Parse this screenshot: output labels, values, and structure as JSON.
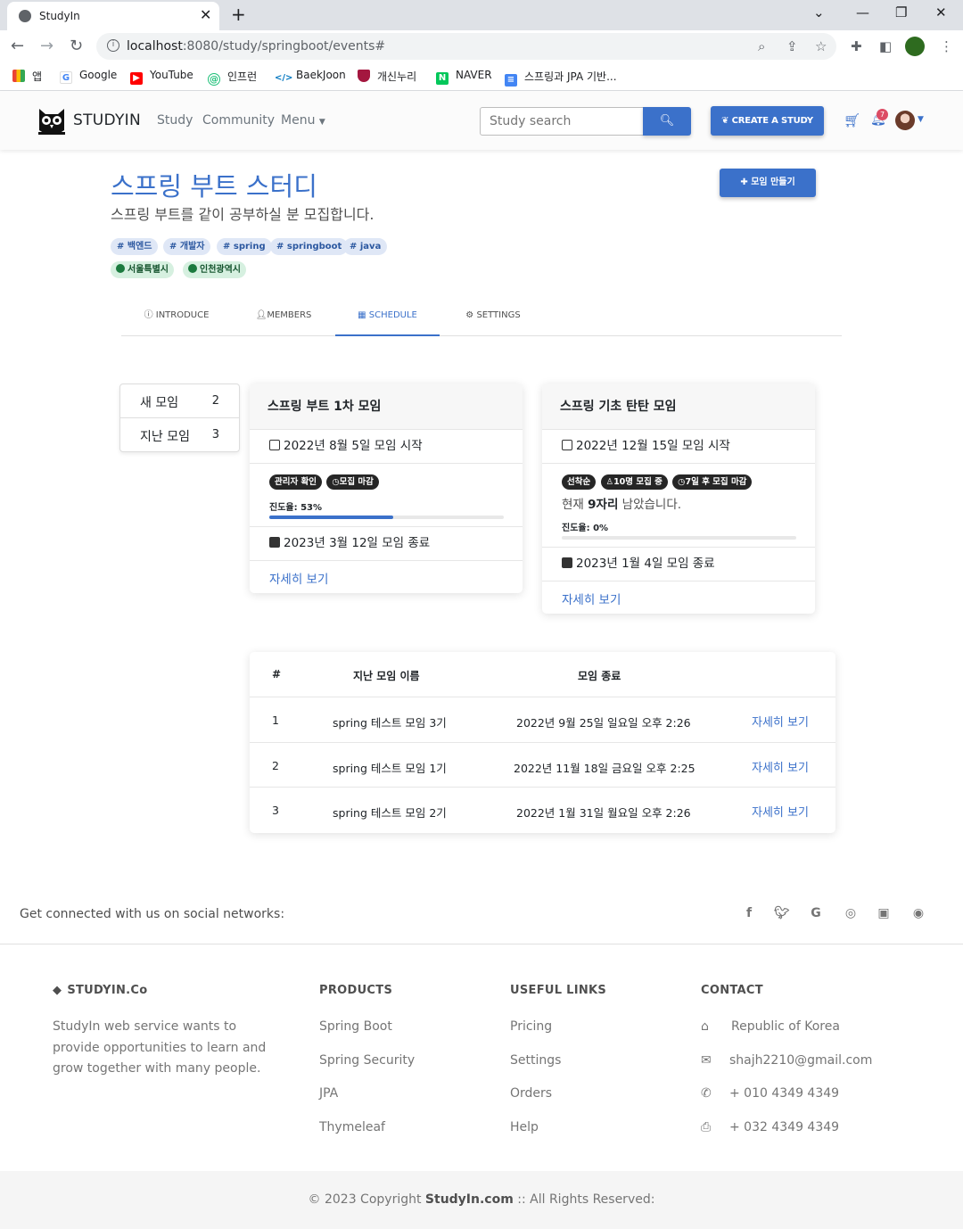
{
  "browser": {
    "tab_title": "StudyIn",
    "url_host": "localhost",
    "url_rest": ":8080/study/springboot/events#",
    "bookmarks": [
      "앱",
      "Google",
      "YouTube",
      "인프런",
      "BaekJoon",
      "개신누리",
      "NAVER",
      "스프링과 JPA 기반..."
    ]
  },
  "nav": {
    "brand": "STUDYIN",
    "links": [
      "Study",
      "Community",
      "Menu"
    ],
    "search_placeholder": "Study search",
    "create_label": "CREATE A STUDY",
    "notif_count": "7"
  },
  "study": {
    "title": "스프링 부트 스터디",
    "description": "스프링 부트를 같이 공부하실 분 모집합니다.",
    "new_meeting_label": "모임 만들기",
    "tags": [
      "백엔드",
      "개발자",
      "spring",
      "springboot",
      "java"
    ],
    "zones": [
      "서울특별시",
      "인천광역시"
    ],
    "tabs": [
      "INTRODUCE",
      "MEMBERS",
      "SCHEDULE",
      "SETTINGS"
    ]
  },
  "side": {
    "items": [
      {
        "label": "새 모임",
        "count": "2"
      },
      {
        "label": "지난 모임",
        "count": "3"
      }
    ]
  },
  "events": [
    {
      "title": "스프링 부트 1차 모임",
      "start": "2022년 8월 5일 모임 시작",
      "badges": [
        "관리자 확인",
        "모집 마감"
      ],
      "status_text": "",
      "progress_label": "진도율: 53%",
      "progress": 0.53,
      "end": "2023년 3월 12일 모임 종료",
      "link": "자세히 보기"
    },
    {
      "title": "스프링 기초 탄탄 모임",
      "start": "2022년 12월 15일 모임 시작",
      "badges": [
        "선착순",
        "10명 모집 중",
        "7일 후 모집 마감"
      ],
      "status_pre": "현재 ",
      "status_bold": "9자리",
      "status_post": " 남았습니다.",
      "progress_label": "진도율: 0%",
      "progress": 0,
      "end": "2023년 1월 4일 모임 종료",
      "link": "자세히 보기"
    }
  ],
  "past": {
    "headers": [
      "#",
      "지난 모임 이름",
      "모임 종료"
    ],
    "rows": [
      {
        "no": "1",
        "name": "spring 테스트 모임 3기",
        "end": "2022년 9월 25일 일요일 오후 2:26",
        "link": "자세히 보기"
      },
      {
        "no": "2",
        "name": "spring 테스트 모임 1기",
        "end": "2022년 11월 18일 금요일 오후 2:25",
        "link": "자세히 보기"
      },
      {
        "no": "3",
        "name": "spring 테스트 모임 2기",
        "end": "2022년 1월 31일 월요일 오후 2:26",
        "link": "자세히 보기"
      }
    ]
  },
  "footer": {
    "social_text": "Get connected with us on social networks:",
    "social_icons": [
      "facebook-icon",
      "twitter-icon",
      "google-icon",
      "instagram-icon",
      "linkedin-icon",
      "github-icon"
    ],
    "brand": "STUDYIN.Co",
    "about": [
      "StudyIn web service wants to",
      "provide opportunities to learn and",
      "grow together with many people."
    ],
    "products_title": "PRODUCTS",
    "products": [
      "Spring Boot",
      "Spring Security",
      "JPA",
      "Thymeleaf"
    ],
    "links_title": "USEFUL LINKS",
    "links": [
      "Pricing",
      "Settings",
      "Orders",
      "Help"
    ],
    "contact_title": "CONTACT",
    "contact": [
      "Republic of Korea",
      "shajh2210@gmail.com",
      "+ 010 4349 4349",
      "+ 032 4349 4349"
    ],
    "copy_pre": "© 2023 Copyright ",
    "copy_bold": "StudyIn.com",
    "copy_post": " :: All Rights Reserved:"
  }
}
